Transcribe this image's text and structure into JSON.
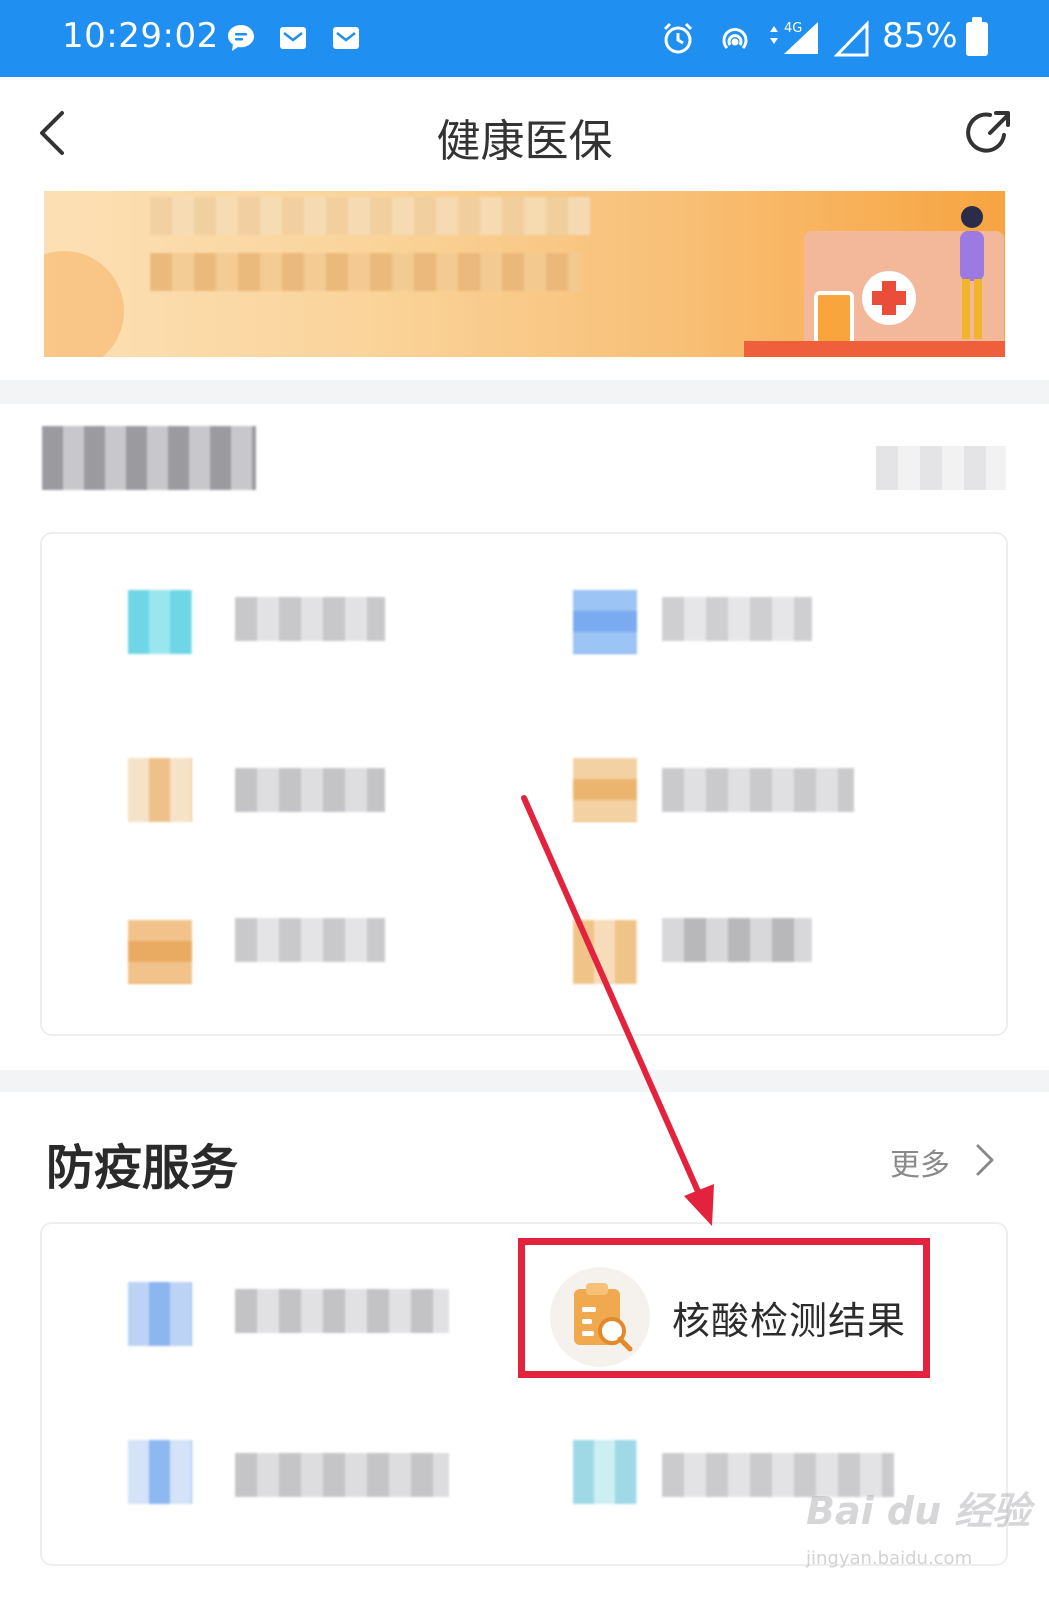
{
  "status_bar": {
    "time": "10:29:02",
    "battery": "85%",
    "network": "4G"
  },
  "nav": {
    "title": "健康医保"
  },
  "section_epidemic": {
    "title": "防疫服务",
    "more_label": "更多",
    "nucleic_test_label": "核酸检测结果"
  },
  "watermark": {
    "brand": "Bai du 经验",
    "url": "jingyan.baidu.com"
  },
  "colors": {
    "status_bar": "#1f8ff2",
    "highlight": "#e3233d",
    "icon_orange": "#f0a94f"
  }
}
